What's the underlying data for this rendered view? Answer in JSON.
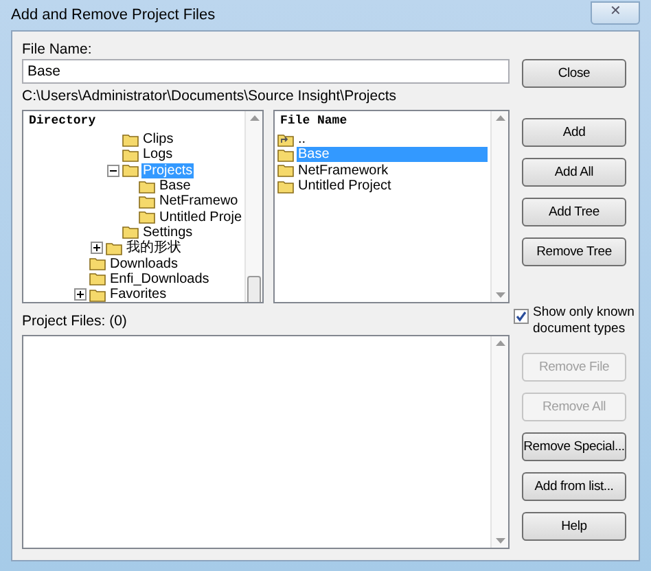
{
  "window": {
    "title": "Add and Remove Project Files",
    "close_label": "✕"
  },
  "file_name": {
    "label": "File Name:",
    "value": "Base"
  },
  "path": "C:\\Users\\Administrator\\Documents\\Source Insight\\Projects",
  "directory": {
    "header": "Directory",
    "nodes": [
      {
        "children": [
          {
            "children": [
              {
                "label": "Clips",
                "selected": false
              },
              {
                "label": "Logs",
                "selected": false
              },
              {
                "label": "Projects",
                "selected": true,
                "expanded": true,
                "children": [
                  {
                    "label": "Base",
                    "selected": false
                  },
                  {
                    "label": "NetFramewo",
                    "selected": false
                  },
                  {
                    "label": "Untitled Proje",
                    "selected": false
                  }
                ]
              },
              {
                "label": "Settings",
                "selected": false
              }
            ]
          },
          {
            "label": "我的形状",
            "selected": false,
            "expanded": false
          }
        ]
      },
      {
        "label": "Downloads",
        "selected": false
      },
      {
        "label": "Enfi_Downloads",
        "selected": false
      },
      {
        "label": "Favorites",
        "selected": false,
        "expanded": false
      }
    ]
  },
  "files": {
    "header": "File Name",
    "items": [
      {
        "label": "..",
        "kind": "parent",
        "selected": false
      },
      {
        "label": "Base",
        "kind": "folder",
        "selected": true
      },
      {
        "label": "NetFramework",
        "kind": "folder",
        "selected": false
      },
      {
        "label": "Untitled Project",
        "kind": "folder",
        "selected": false
      }
    ]
  },
  "close_button": {
    "label": "Close",
    "disabled": false
  },
  "top_buttons": [
    {
      "label": "Add",
      "disabled": false
    },
    {
      "label": "Add All",
      "disabled": false
    },
    {
      "label": "Add Tree",
      "disabled": false
    },
    {
      "label": "Remove Tree",
      "disabled": false
    }
  ],
  "known_types": {
    "label": "Show only known document types",
    "checked": true
  },
  "project_files": {
    "label": "Project Files: (0)"
  },
  "bottom_buttons": [
    {
      "label": "Remove File",
      "disabled": true
    },
    {
      "label": "Remove All",
      "disabled": true
    },
    {
      "label": "Remove Special...",
      "disabled": false
    },
    {
      "label": "Add from list...",
      "disabled": false
    },
    {
      "label": "Help",
      "disabled": false
    }
  ]
}
